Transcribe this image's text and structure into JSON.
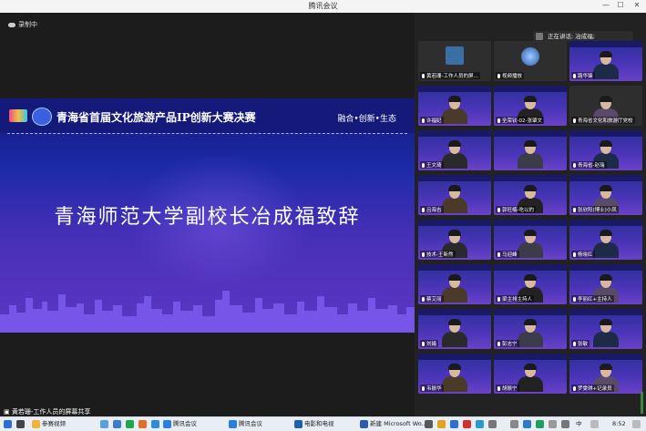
{
  "window": {
    "title": "腾讯会议"
  },
  "recording": {
    "label": "录制中"
  },
  "slide": {
    "title": "青海省首届文化旅游产品IP创新大赛决赛",
    "tagline": "融合•创新•生态",
    "headline": "青海师范大学副校长冶成福致辞"
  },
  "sharer": {
    "label": "黄若珊-工作人员的屏幕共享"
  },
  "speaking": {
    "label": "正在讲话: 冶成福;"
  },
  "participants": [
    {
      "name": "黄若珊-工作人员的屏...",
      "kind": "avatar"
    },
    {
      "name": "视频播放",
      "kind": "globe"
    },
    {
      "name": "路华锋",
      "kind": "slide"
    },
    {
      "name": "许福妃",
      "kind": "slide"
    },
    {
      "name": "全荣钦-02-张肇文",
      "kind": "slide"
    },
    {
      "name": "青海省文化和旅游厅党校",
      "kind": "plain"
    },
    {
      "name": "王文琦",
      "kind": "slide"
    },
    {
      "name": "",
      "kind": "slide"
    },
    {
      "name": "青海省-赵瑞",
      "kind": "slide"
    },
    {
      "name": "吕海吉",
      "kind": "slide"
    },
    {
      "name": "郭旺楠-吃以的",
      "kind": "slide"
    },
    {
      "name": "张欣阳(博士)小凤",
      "kind": "slide"
    },
    {
      "name": "技术-王新然",
      "kind": "slide"
    },
    {
      "name": "马迎峰",
      "kind": "slide"
    },
    {
      "name": "杨晓红",
      "kind": "slide"
    },
    {
      "name": "蔡艾丽",
      "kind": "slide"
    },
    {
      "name": "梁主排主持人",
      "kind": "slide"
    },
    {
      "name": "李丽红+主持人",
      "kind": "slide"
    },
    {
      "name": "刘嫱",
      "kind": "slide"
    },
    {
      "name": "彭志宁",
      "kind": "slide"
    },
    {
      "name": "张敏",
      "kind": "slide"
    },
    {
      "name": "韦振华",
      "kind": "slide"
    },
    {
      "name": "胡振宁",
      "kind": "slide"
    },
    {
      "name": "罗雯琪+记录员",
      "kind": "slide"
    }
  ],
  "taskbar": {
    "items": [
      {
        "label": "参赛视频",
        "color": "#f2b33a"
      },
      {
        "label": "腾讯会议",
        "color": "#2b7de0"
      },
      {
        "label": "腾讯会议",
        "color": "#2b7de0"
      },
      {
        "label": "电影和电视",
        "color": "#1f5fb0"
      },
      {
        "label": "新建 Microsoft Wo...",
        "color": "#2a5caa"
      }
    ],
    "lang": "中",
    "time": "8:52"
  }
}
